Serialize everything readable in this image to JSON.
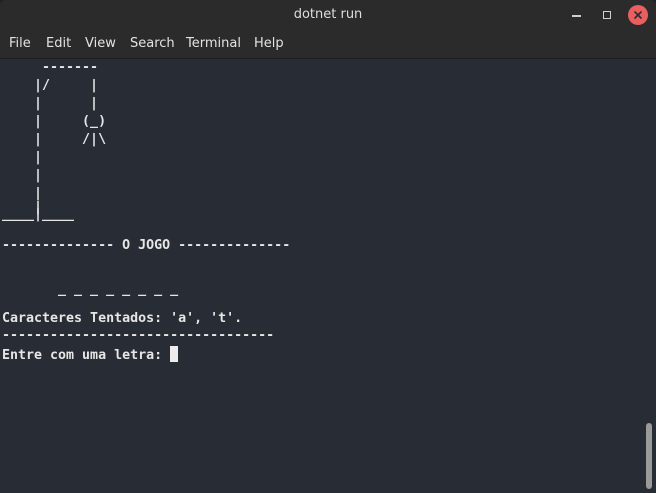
{
  "window": {
    "title": "dotnet run"
  },
  "menubar": {
    "items": [
      {
        "label": "File"
      },
      {
        "label": "Edit"
      },
      {
        "label": "View"
      },
      {
        "label": "Search"
      },
      {
        "label": "Terminal"
      },
      {
        "label": "Help"
      }
    ]
  },
  "terminal": {
    "gallows": [
      "     -------",
      "    |/     |",
      "    |      |",
      "    |     (_)",
      "    |     /|\\",
      "    |",
      "    |",
      "    |",
      "    |",
      "____|____"
    ],
    "header": "-------------- O JOGO --------------",
    "word_display": "       _ _ _ _ _ _ _ _",
    "tried_label": "Caracteres Tentados: 'a', 't'.",
    "separator": "----------------------------------",
    "prompt": "Entre com uma letra: "
  },
  "colors": {
    "titlebar": "#2b2b2b",
    "terminal_bg": "#282c34",
    "text": "#e6e6e6",
    "close_button": "#e95f5f"
  },
  "icons": [
    "minimize-icon",
    "maximize-icon",
    "close-icon"
  ]
}
